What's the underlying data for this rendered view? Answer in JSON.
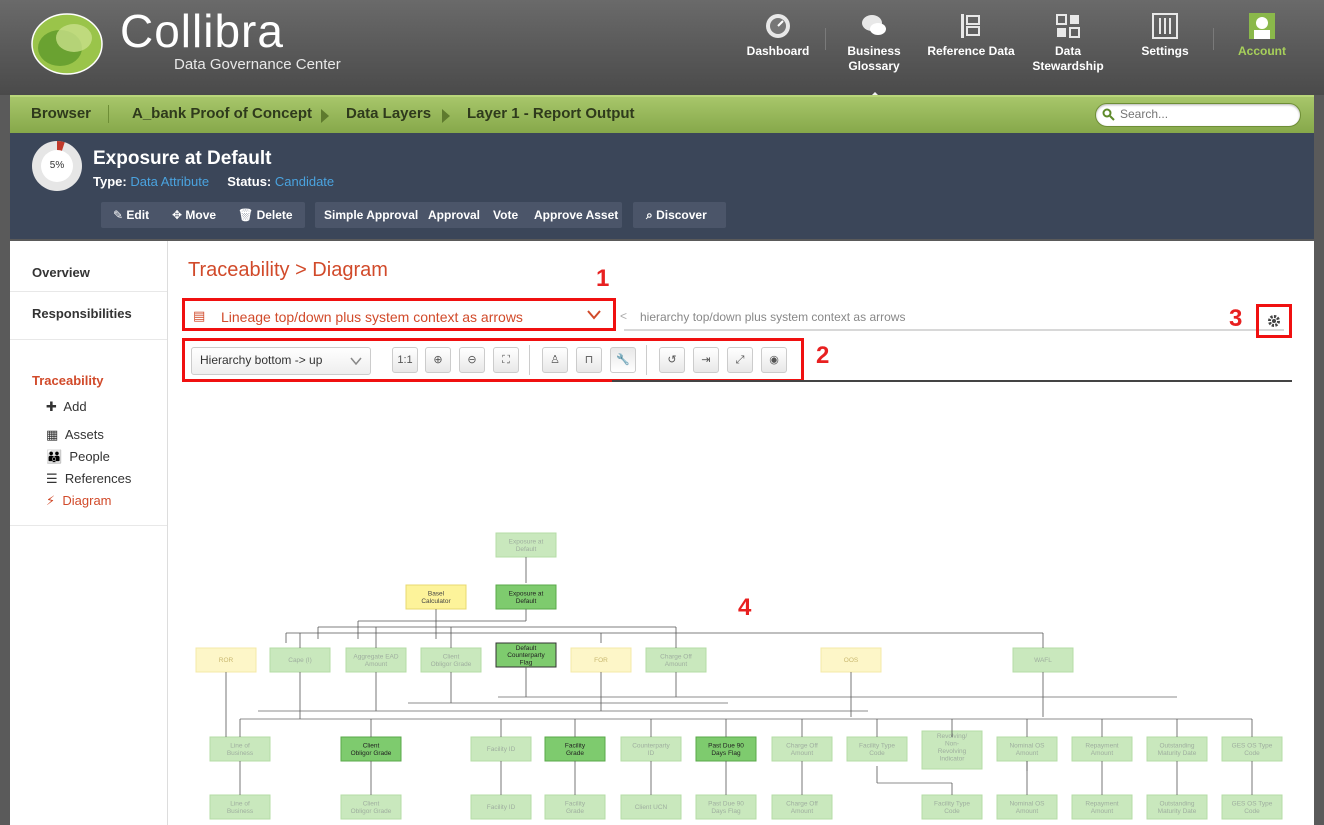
{
  "app": {
    "logo_name": "Collibra",
    "logo_sub": "Data Governance Center"
  },
  "nav": [
    {
      "label": "Dashboard",
      "icon": "dashboard-icon"
    },
    {
      "label": "Business Glossary",
      "icon": "speech-bubbles-icon",
      "active": true
    },
    {
      "label": "Reference Data",
      "icon": "reference-data-icon"
    },
    {
      "label": "Data Stewardship",
      "icon": "stewardship-icon"
    },
    {
      "label": "Settings",
      "icon": "sliders-icon"
    },
    {
      "label": "Account",
      "icon": "user-icon"
    }
  ],
  "breadcrumb": [
    "Browser",
    "A_bank Proof of Concept",
    "Data Layers",
    "Layer 1 - Report Output"
  ],
  "search": {
    "placeholder": "Search..."
  },
  "asset": {
    "progress_label": "5%",
    "progress": 5,
    "title": "Exposure at Default",
    "type_label": "Type:",
    "type_value": "Data Attribute",
    "status_label": "Status:",
    "status_value": "Candidate"
  },
  "actions": {
    "edit": "Edit",
    "move": "Move",
    "delete": "Delete",
    "simple_approval": "Simple Approval",
    "approval": "Approval",
    "vote": "Vote",
    "approve_asset": "Approve Asset",
    "discover": "Discover"
  },
  "sidebar": {
    "overview": "Overview",
    "responsibilities": "Responsibilities",
    "traceability": "Traceability",
    "items": [
      {
        "label": "Add",
        "icon": "plus-icon"
      },
      {
        "label": "Assets",
        "icon": "table-icon"
      },
      {
        "label": "People",
        "icon": "people-icon"
      },
      {
        "label": "References",
        "icon": "list-icon"
      },
      {
        "label": "Diagram",
        "icon": "diagram-icon",
        "selected": true
      }
    ]
  },
  "main": {
    "title": "Traceability > Diagram",
    "view_selected": "Lineage top/down plus system context as arrows",
    "view_desc": "hierarchy top/down plus system context as arrows",
    "layout_selected": "Hierarchy bottom -> up",
    "tools": [
      "1:1",
      "zoom-in",
      "zoom-out",
      "fit",
      "hierarchy",
      "org",
      "tools",
      "refresh",
      "export",
      "fullscreen",
      "eye"
    ]
  },
  "annotations": [
    "1",
    "2",
    "3",
    "4"
  ],
  "diagram": {
    "top": [
      "Exposure at Default"
    ],
    "level2": [
      "Basel Calculator",
      "Exposure at Default"
    ],
    "level3": [
      "ROR",
      "Cape (I)",
      "Aggregate EAD Amount",
      "Client Obligor Grade",
      "Default Counterparty Flag",
      "FOR",
      "Charge Off Amount",
      "OOS",
      "WAFL"
    ],
    "level4": [
      "Line of Business",
      "Client Obligor Grade",
      "Facility ID",
      "Facility Grade",
      "Counterparty ID",
      "Past Due 90 Days Flag",
      "Charge Off Amount",
      "Facility Type Code",
      "Revolving/ Non-Revolving Indicator",
      "Nominal OS Amount",
      "Repayment Amount",
      "Outstanding Maturity Date",
      "GES OS Type Code"
    ],
    "level5": [
      "Line of Business",
      "Client Obligor Grade",
      "Facility ID",
      "Facility Grade",
      "Client UCN",
      "Past Due 90 Days Flag",
      "Charge Off Amount",
      "Facility Type Code",
      "Nominal OS Amount",
      "Repayment Amount",
      "Outstanding Maturity Date",
      "GES OS Type Code"
    ]
  }
}
